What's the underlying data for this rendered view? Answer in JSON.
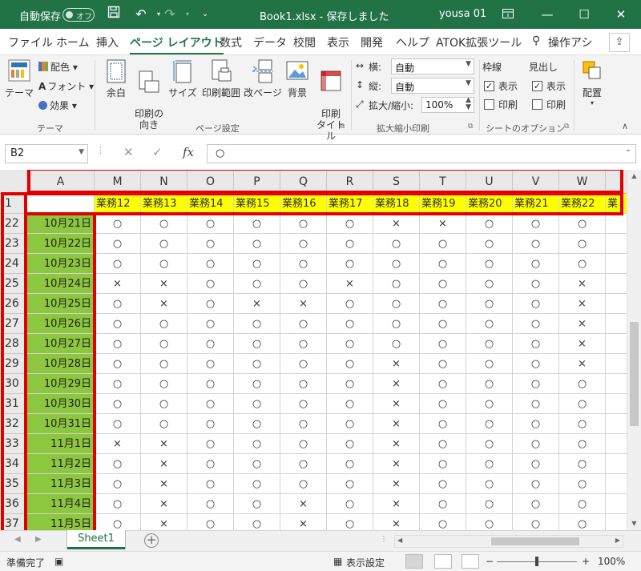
{
  "titlebar": {
    "autosave_label": "自動保存",
    "autosave_state": "オフ",
    "title": "Book1.xlsx  -  保存しました",
    "user": "yousa 01"
  },
  "tabs": [
    "ファイル",
    "ホーム",
    "挿入",
    "ページ レイアウト",
    "数式",
    "データ",
    "校閲",
    "表示",
    "開発",
    "ヘルプ",
    "ATOK拡張ツール",
    "操作アシ"
  ],
  "active_tab": "ページ レイアウト",
  "ribbon": {
    "theme": {
      "theme_label": "テーマ",
      "color_label": "配色",
      "font_label": "フォント",
      "effect_label": "効果",
      "group": "テーマ"
    },
    "page_setup": {
      "margin": "余白",
      "orientation": "印刷の\n向き",
      "size": "サイズ",
      "print_area": "印刷範囲",
      "breaks": "改ページ",
      "background": "背景",
      "print_titles": "印刷\nタイトル",
      "group": "ページ設定"
    },
    "scale": {
      "width_label": "横:",
      "width_value": "自動",
      "height_label": "縦:",
      "height_value": "自動",
      "scale_label": "拡大/縮小:",
      "scale_value": "100%",
      "group": "拡大縮小印刷"
    },
    "sheet_options": {
      "gridlines": "枠線",
      "headings": "見出し",
      "view": "表示",
      "print": "印刷",
      "group": "シートのオプション"
    },
    "arrange": {
      "label": "配置"
    }
  },
  "formula_bar": {
    "name_box": "B2",
    "fx": "fx",
    "value": "○"
  },
  "grid": {
    "columns": [
      "A",
      "M",
      "N",
      "O",
      "P",
      "Q",
      "R",
      "S",
      "T",
      "U",
      "V",
      "W"
    ],
    "header_row": {
      "row": "1",
      "cells": [
        "",
        "業務12",
        "業務13",
        "業務14",
        "業務15",
        "業務16",
        "業務17",
        "業務18",
        "業務19",
        "業務20",
        "業務21",
        "業務22",
        "業"
      ]
    },
    "rows": [
      {
        "row": "22",
        "date": "10月21日",
        "marks": [
          "○",
          "○",
          "○",
          "○",
          "○",
          "○",
          "×",
          "×",
          "○",
          "○",
          "○"
        ]
      },
      {
        "row": "23",
        "date": "10月22日",
        "marks": [
          "○",
          "○",
          "○",
          "○",
          "○",
          "○",
          "○",
          "○",
          "○",
          "○",
          "○"
        ]
      },
      {
        "row": "24",
        "date": "10月23日",
        "marks": [
          "○",
          "○",
          "○",
          "○",
          "○",
          "○",
          "○",
          "○",
          "○",
          "○",
          "○"
        ]
      },
      {
        "row": "25",
        "date": "10月24日",
        "marks": [
          "×",
          "×",
          "○",
          "○",
          "○",
          "×",
          "○",
          "○",
          "○",
          "○",
          "×"
        ]
      },
      {
        "row": "26",
        "date": "10月25日",
        "marks": [
          "○",
          "×",
          "○",
          "×",
          "×",
          "○",
          "○",
          "○",
          "○",
          "○",
          "×"
        ]
      },
      {
        "row": "27",
        "date": "10月26日",
        "marks": [
          "○",
          "○",
          "○",
          "○",
          "○",
          "○",
          "○",
          "○",
          "○",
          "○",
          "×"
        ]
      },
      {
        "row": "28",
        "date": "10月27日",
        "marks": [
          "○",
          "○",
          "○",
          "○",
          "○",
          "○",
          "○",
          "○",
          "○",
          "○",
          "×"
        ]
      },
      {
        "row": "29",
        "date": "10月28日",
        "marks": [
          "○",
          "○",
          "○",
          "○",
          "○",
          "○",
          "×",
          "○",
          "○",
          "○",
          "×"
        ]
      },
      {
        "row": "30",
        "date": "10月29日",
        "marks": [
          "○",
          "○",
          "○",
          "○",
          "○",
          "○",
          "×",
          "○",
          "○",
          "○",
          "○"
        ]
      },
      {
        "row": "31",
        "date": "10月30日",
        "marks": [
          "○",
          "○",
          "○",
          "○",
          "○",
          "○",
          "×",
          "○",
          "○",
          "○",
          "○"
        ]
      },
      {
        "row": "32",
        "date": "10月31日",
        "marks": [
          "○",
          "○",
          "○",
          "○",
          "○",
          "○",
          "×",
          "○",
          "○",
          "○",
          "○"
        ]
      },
      {
        "row": "33",
        "date": "11月1日",
        "marks": [
          "×",
          "×",
          "○",
          "○",
          "○",
          "○",
          "×",
          "○",
          "○",
          "○",
          "○"
        ]
      },
      {
        "row": "34",
        "date": "11月2日",
        "marks": [
          "○",
          "×",
          "○",
          "○",
          "○",
          "○",
          "×",
          "○",
          "○",
          "○",
          "○"
        ]
      },
      {
        "row": "35",
        "date": "11月3日",
        "marks": [
          "○",
          "×",
          "○",
          "○",
          "○",
          "○",
          "×",
          "○",
          "○",
          "○",
          "○"
        ]
      },
      {
        "row": "36",
        "date": "11月4日",
        "marks": [
          "○",
          "×",
          "○",
          "○",
          "×",
          "○",
          "×",
          "○",
          "○",
          "○",
          "○"
        ]
      },
      {
        "row": "37",
        "date": "11月5日",
        "marks": [
          "○",
          "×",
          "○",
          "○",
          "×",
          "○",
          "×",
          "○",
          "○",
          "○",
          "○"
        ]
      }
    ]
  },
  "sheet_tabs": {
    "active": "Sheet1"
  },
  "status": {
    "ready": "準備完了",
    "display_settings": "表示設定",
    "zoom": "100%",
    "zoom_level": 0.5
  },
  "colors": {
    "brand": "#217346",
    "header_fill": "#ffff00",
    "date_fill": "#8dc63f",
    "highlight_border": "#e00000"
  }
}
